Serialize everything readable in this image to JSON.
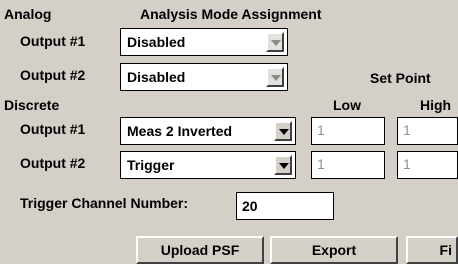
{
  "headers": {
    "analog": "Analog",
    "mode_assignment": "Analysis Mode Assignment",
    "set_point": "Set Point",
    "discrete": "Discrete",
    "low": "Low",
    "high": "High"
  },
  "analog_outputs": [
    {
      "label": "Output #1",
      "value": "Disabled"
    },
    {
      "label": "Output #2",
      "value": "Disabled"
    }
  ],
  "discrete_outputs": [
    {
      "label": "Output #1",
      "value": "Meas 2 Inverted",
      "low": "1",
      "high": "1"
    },
    {
      "label": "Output #2",
      "value": "Trigger",
      "low": "1",
      "high": "1"
    }
  ],
  "trigger": {
    "label": "Trigger Channel Number:",
    "value": "20"
  },
  "buttons": {
    "upload": "Upload PSF",
    "export": "Export",
    "third": "Fi"
  },
  "icons": {
    "dropdown": "chevron-down-icon"
  }
}
